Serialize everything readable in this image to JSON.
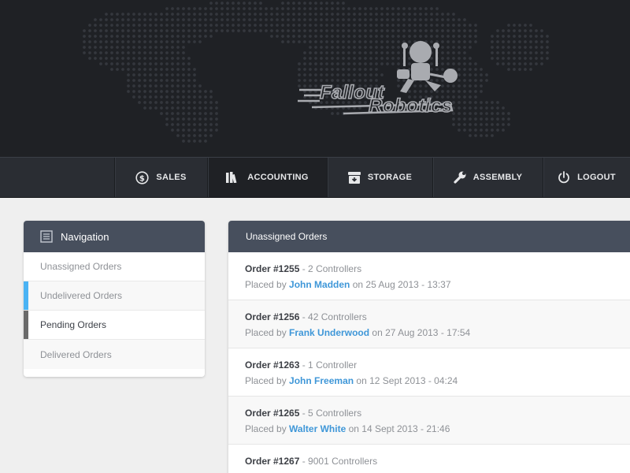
{
  "brand": {
    "line1": "Fallout",
    "line2": "Robotics"
  },
  "topnav": {
    "items": [
      {
        "label": "SALES",
        "icon": "dollar-circle-icon"
      },
      {
        "label": "ACCOUNTING",
        "icon": "books-icon"
      },
      {
        "label": "STORAGE",
        "icon": "archive-box-icon"
      },
      {
        "label": "ASSEMBLY",
        "icon": "wrench-icon"
      },
      {
        "label": "LOGOUT",
        "icon": "power-icon"
      }
    ],
    "active_index": 1
  },
  "sidebar": {
    "title": "Navigation",
    "title_icon": "list-document-icon",
    "items": [
      {
        "label": "Unassigned Orders"
      },
      {
        "label": "Undelivered Orders",
        "marker_color": "#4ab3f4"
      },
      {
        "label": "Pending Orders",
        "marker_color": "#6a6a6a"
      },
      {
        "label": "Delivered Orders"
      }
    ]
  },
  "orders": {
    "title": "Unassigned Orders",
    "placed_by_prefix": "Placed by",
    "rows": [
      {
        "id": "Order #1255",
        "qty": " - 2 Controllers",
        "customer": "John Madden",
        "when": " on 25 Aug 2013 - 13:37"
      },
      {
        "id": "Order #1256",
        "qty": " - 42 Controllers",
        "customer": "Frank Underwood",
        "when": " on 27 Aug 2013 - 17:54"
      },
      {
        "id": "Order #1263",
        "qty": " - 1 Controller",
        "customer": "John Freeman",
        "when": " on 12 Sept 2013 - 04:24"
      },
      {
        "id": "Order #1265",
        "qty": " - 5 Controllers",
        "customer": "Walter White",
        "when": " on 14 Sept 2013 - 21:46"
      },
      {
        "id": "Order #1267",
        "qty": " - 9001 Controllers",
        "customer": "",
        "when": ""
      }
    ]
  },
  "colors": {
    "header_bg": "#1f2125",
    "panel_header": "#474f5d",
    "link": "#3f97d8"
  }
}
